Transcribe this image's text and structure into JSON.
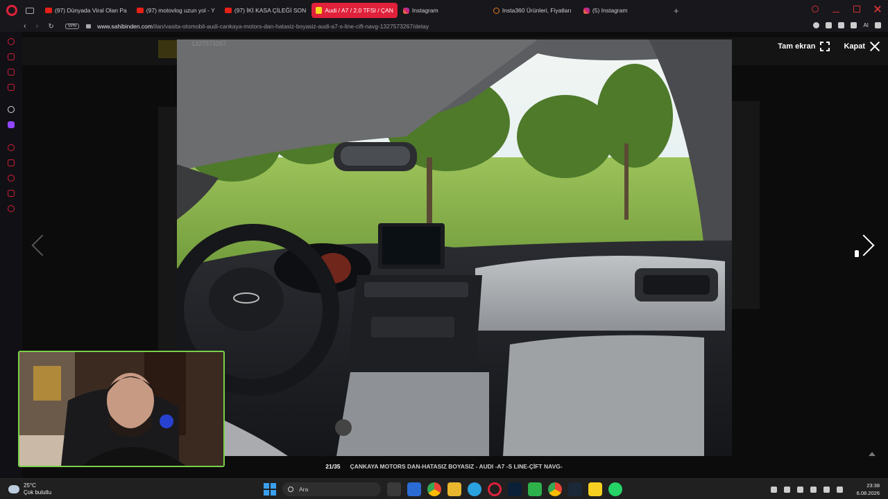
{
  "browser": {
    "tabs": [
      {
        "label": "(97) Dünyada Viral Olan Pa",
        "icon": "youtube-icon",
        "active": false
      },
      {
        "label": "(97) motovlog uzun yol - Y",
        "icon": "youtube-icon",
        "active": false
      },
      {
        "label": "(97) İKİ KASA ÇİLEĞİ SON",
        "icon": "youtube-icon",
        "active": false
      },
      {
        "label": "Audi / A7 / 2.0 TFSI / ÇAN",
        "icon": "sahibinden-icon",
        "active": true
      },
      {
        "label": "Instagram",
        "icon": "instagram-icon",
        "active": false
      },
      {
        "label": "Insta360 Ürünleri, Fiyatları",
        "icon": "insta360-icon",
        "active": false
      },
      {
        "label": "(5) Instagram",
        "icon": "instagram-icon",
        "active": false
      }
    ],
    "new_tab": "+",
    "vpn_label": "VPN",
    "url_domain": "www.sahibinden.com",
    "url_path": "/ilan/vasita-otomobil-audi-cankaya-motors-dan-hatasiz-boyasiz-audi-a7-s-line-cift-navg-1327573267/detay",
    "ai_label": "AI",
    "accent": "#e0213b"
  },
  "lightbox": {
    "ad_number": "1327573267",
    "fullscreen_label": "Tam ekran",
    "close_label": "Kapat",
    "counter": "21/35",
    "caption": "ÇANKAYA MOTORS DAN-HATASIZ BOYASIZ - AUDI -A7 -S LINE-ÇİFT NAVG-"
  },
  "taskbar": {
    "weather_temp": "25°C",
    "weather_desc": "Çok bulutlu",
    "search_placeholder": "Ara",
    "time": "23:38",
    "date": "6.08.2026"
  }
}
